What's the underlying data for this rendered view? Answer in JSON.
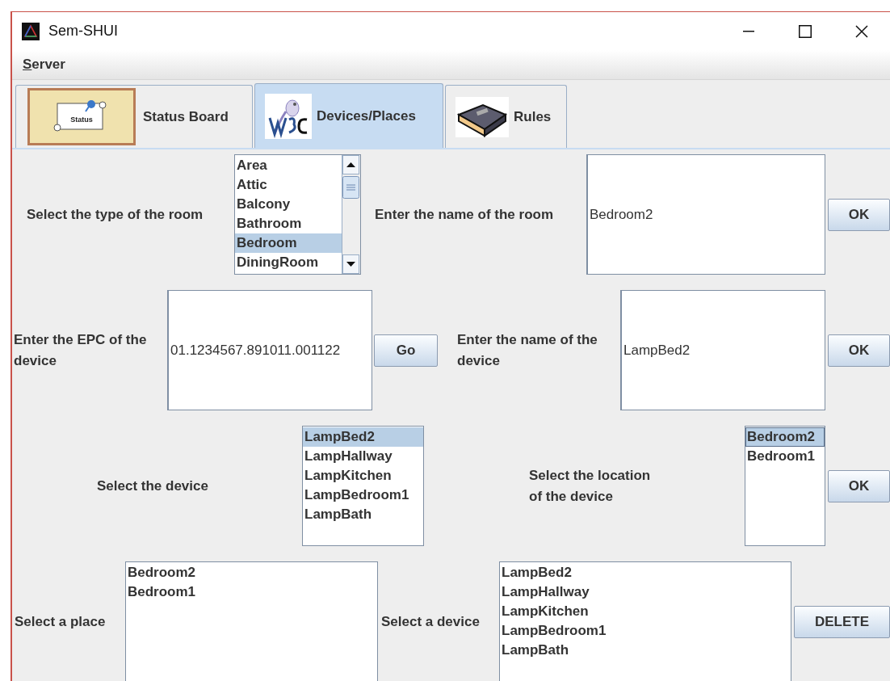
{
  "window": {
    "title": "Sem-SHUI"
  },
  "menu": [
    {
      "label": "Server"
    }
  ],
  "tabs": [
    {
      "label": "Status Board",
      "icon_text": "Status",
      "selected": false
    },
    {
      "label": "Devices/Places",
      "selected": true
    },
    {
      "label": "Rules",
      "selected": false
    }
  ],
  "form_rows": [
    {
      "items": [
        {
          "kind": "label",
          "text": "Select the type of the room"
        },
        {
          "kind": "list",
          "scrollbar": true,
          "items": [
            {
              "text": "Area",
              "selected": false
            },
            {
              "text": "Attic",
              "selected": false
            },
            {
              "text": "Balcony",
              "selected": false
            },
            {
              "text": "Bathroom",
              "selected": false
            },
            {
              "text": "Bedroom",
              "selected": true
            },
            {
              "text": "DiningRoom",
              "selected": false
            }
          ]
        },
        {
          "kind": "label",
          "text": "Enter the name of the room"
        },
        {
          "kind": "field",
          "value": "Bedroom2"
        },
        {
          "kind": "button",
          "label": "OK"
        }
      ]
    },
    {
      "items": [
        {
          "kind": "label",
          "text": "Enter the EPC of the\ndevice"
        },
        {
          "kind": "field",
          "value": "01.1234567.891011.001122"
        },
        {
          "kind": "button",
          "label": "Go"
        },
        {
          "kind": "label",
          "text": "Enter the name of the\ndevice"
        },
        {
          "kind": "field",
          "value": "LampBed2"
        },
        {
          "kind": "button",
          "label": "OK"
        }
      ]
    },
    {
      "items": [
        {
          "kind": "label",
          "text": "Select the device"
        },
        {
          "kind": "list",
          "items": [
            {
              "text": "LampBed2",
              "selected": true
            },
            {
              "text": "LampHallway",
              "selected": false
            },
            {
              "text": "LampKitchen",
              "selected": false
            },
            {
              "text": "LampBedroom1",
              "selected": false
            },
            {
              "text": "LampBath",
              "selected": false
            }
          ]
        },
        {
          "kind": "label",
          "text": "Select the location\nof the device"
        },
        {
          "kind": "list",
          "focused": true,
          "items": [
            {
              "text": "Bedroom2",
              "selected": true
            },
            {
              "text": "Bedroom1",
              "selected": false
            }
          ]
        },
        {
          "kind": "button",
          "label": "OK"
        }
      ]
    },
    {
      "items": [
        {
          "kind": "label",
          "text": "Select a place"
        },
        {
          "kind": "list",
          "items": [
            {
              "text": "Bedroom2",
              "selected": false
            },
            {
              "text": "Bedroom1",
              "selected": false
            }
          ]
        },
        {
          "kind": "label",
          "text": "Select a device"
        },
        {
          "kind": "list",
          "items": [
            {
              "text": "LampBed2",
              "selected": false
            },
            {
              "text": "LampHallway",
              "selected": false
            },
            {
              "text": "LampKitchen",
              "selected": false
            },
            {
              "text": "LampBedroom1",
              "selected": false
            },
            {
              "text": "LampBath",
              "selected": false
            }
          ]
        },
        {
          "kind": "button",
          "label": "DELETE"
        }
      ]
    }
  ]
}
